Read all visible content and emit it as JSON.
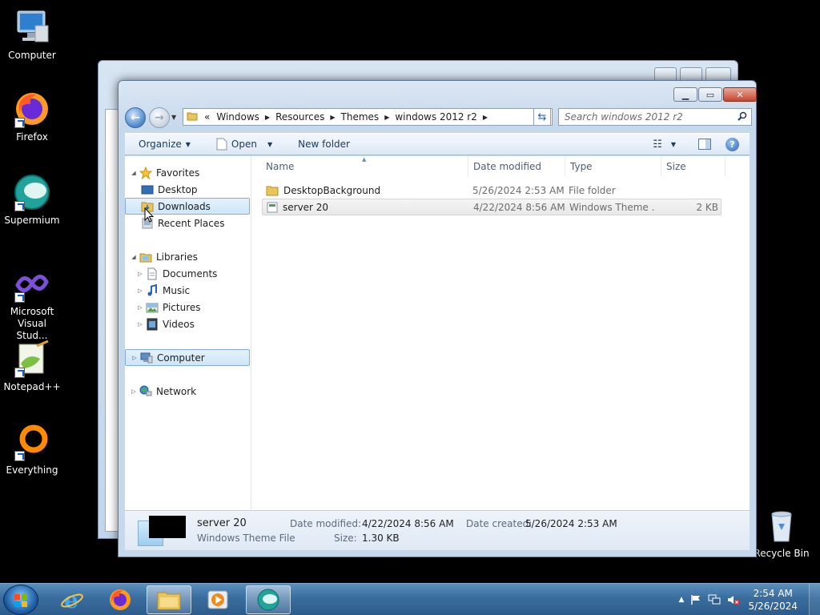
{
  "desktop": {
    "icons": [
      {
        "label": "Computer"
      },
      {
        "label": "Firefox"
      },
      {
        "label": "Supermium"
      },
      {
        "label": "Microsoft Visual Stud..."
      },
      {
        "label": "Notepad++"
      },
      {
        "label": "Everything"
      }
    ],
    "recycle_bin": "Recycle Bin"
  },
  "window": {
    "address": {
      "overflow": "«",
      "crumbs": [
        "Windows",
        "Resources",
        "Themes",
        "windows 2012 r2"
      ]
    },
    "search_placeholder": "Search windows 2012 r2",
    "toolbar": {
      "organize": "Organize",
      "open": "Open",
      "new_folder": "New folder"
    },
    "nav": {
      "favorites": "Favorites",
      "desktop": "Desktop",
      "downloads": "Downloads",
      "recent_places": "Recent Places",
      "libraries": "Libraries",
      "documents": "Documents",
      "music": "Music",
      "pictures": "Pictures",
      "videos": "Videos",
      "computer": "Computer",
      "network": "Network"
    },
    "columns": {
      "name": "Name",
      "date_modified": "Date modified",
      "type": "Type",
      "size": "Size"
    },
    "files": [
      {
        "name": "DesktopBackground",
        "date": "5/26/2024 2:53 AM",
        "type": "File folder",
        "size": ""
      },
      {
        "name": "server 20",
        "date": "4/22/2024 8:56 AM",
        "type": "Windows Theme ...",
        "size": "2 KB"
      }
    ],
    "details": {
      "name": "server 20",
      "type": "Windows Theme File",
      "date_modified_label": "Date modified:",
      "date_modified": "4/22/2024 8:56 AM",
      "date_created_label": "Date created:",
      "date_created": "5/26/2024 2:53 AM",
      "size_label": "Size:",
      "size": "1.30 KB"
    }
  },
  "taskbar": {
    "time": "2:54 AM",
    "date": "5/26/2024"
  },
  "colors": {
    "taskbar": "#3a6d9e",
    "selection": "#cde6f8",
    "desktop": "#000000"
  }
}
